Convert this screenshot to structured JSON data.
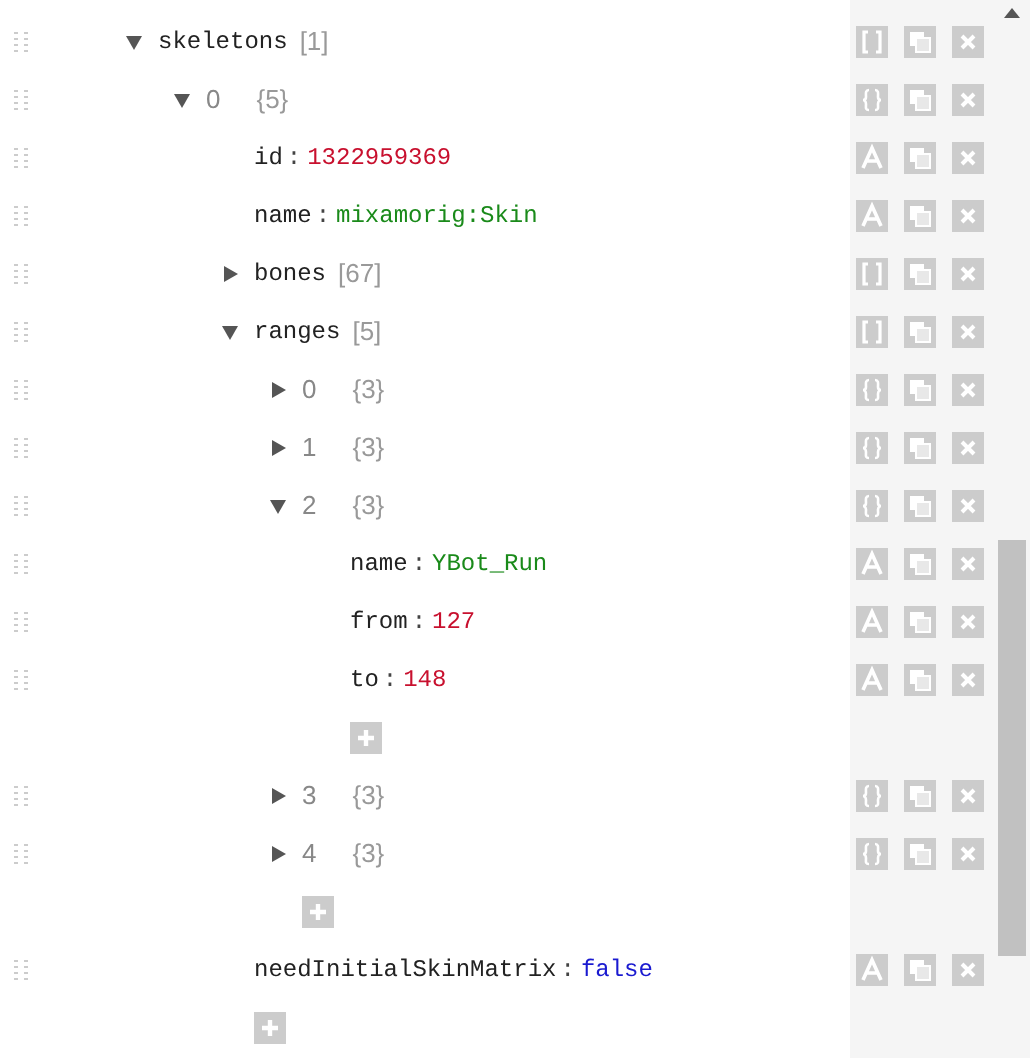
{
  "nodes": [
    {
      "kind": "array",
      "key": "skeletons",
      "count": "[1]",
      "expanded": true,
      "children": [
        {
          "kind": "object",
          "key": "0",
          "count": "{5}",
          "expanded": true,
          "children": [
            {
              "kind": "number",
              "key": "id",
              "separator": ":",
              "value": "1322959369"
            },
            {
              "kind": "string",
              "key": "name",
              "separator": ":",
              "value": "mixamorig:Skin"
            },
            {
              "kind": "array",
              "key": "bones",
              "count": "[67]",
              "expanded": false
            },
            {
              "kind": "array",
              "key": "ranges",
              "count": "[5]",
              "expanded": true,
              "children": [
                {
                  "kind": "object",
                  "key": "0",
                  "count": "{3}",
                  "expanded": false
                },
                {
                  "kind": "object",
                  "key": "1",
                  "count": "{3}",
                  "expanded": false
                },
                {
                  "kind": "object",
                  "key": "2",
                  "count": "{3}",
                  "expanded": true,
                  "children": [
                    {
                      "kind": "string",
                      "key": "name",
                      "separator": ":",
                      "value": "YBot_Run"
                    },
                    {
                      "kind": "number",
                      "key": "from",
                      "separator": ":",
                      "value": "127"
                    },
                    {
                      "kind": "number",
                      "key": "to",
                      "separator": ":",
                      "value": "148"
                    },
                    {
                      "kind": "add"
                    }
                  ]
                },
                {
                  "kind": "object",
                  "key": "3",
                  "count": "{3}",
                  "expanded": false
                },
                {
                  "kind": "object",
                  "key": "4",
                  "count": "{3}",
                  "expanded": false
                },
                {
                  "kind": "add"
                }
              ]
            },
            {
              "kind": "boolean",
              "key": "needInitialSkinMatrix",
              "separator": ":",
              "value": "false"
            },
            {
              "kind": "add"
            }
          ]
        }
      ]
    }
  ]
}
